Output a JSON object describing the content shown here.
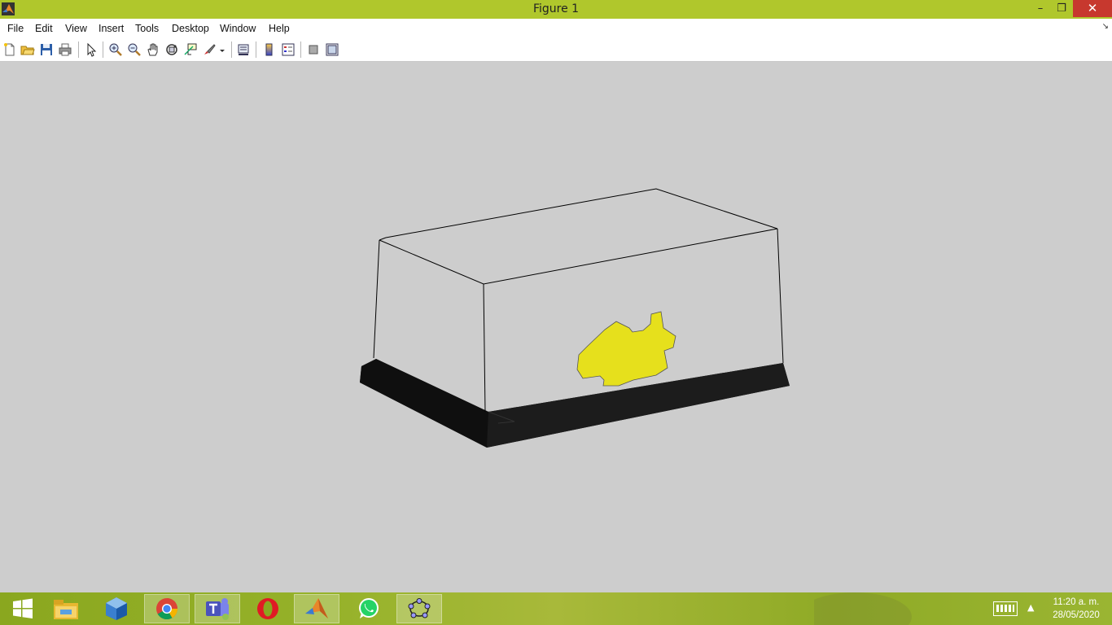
{
  "window": {
    "title": "Figure 1",
    "min_label": "–",
    "max_label": "❐",
    "close_label": "✕"
  },
  "menu": {
    "file": "File",
    "edit": "Edit",
    "view": "View",
    "insert": "Insert",
    "tools": "Tools",
    "desktop": "Desktop",
    "window": "Window",
    "help": "Help"
  },
  "toolbar_icons": [
    "new-figure-icon",
    "open-file-icon",
    "save-icon",
    "print-icon",
    "edit-plot-arrow-icon",
    "zoom-in-icon",
    "zoom-out-icon",
    "pan-hand-icon",
    "rotate-3d-icon",
    "data-cursor-icon",
    "brush-icon",
    "link-plot-icon",
    "colorbar-icon",
    "legend-icon",
    "hide-plot-tools-icon",
    "show-plot-tools-icon"
  ],
  "colors": {
    "titlebar": "#b0c72c",
    "close": "#c7382e",
    "fish": "#e6e01c",
    "base": "#141414",
    "background": "#cdcdcd"
  },
  "taskbar": {
    "apps": [
      "windows-start-icon",
      "file-explorer-icon",
      "virtualbox-icon",
      "chrome-icon",
      "teams-icon",
      "opera-icon",
      "matlab-icon",
      "whatsapp-icon",
      "geogebra-icon"
    ],
    "time": "11:20 a. m.",
    "date": "28/05/2020"
  }
}
